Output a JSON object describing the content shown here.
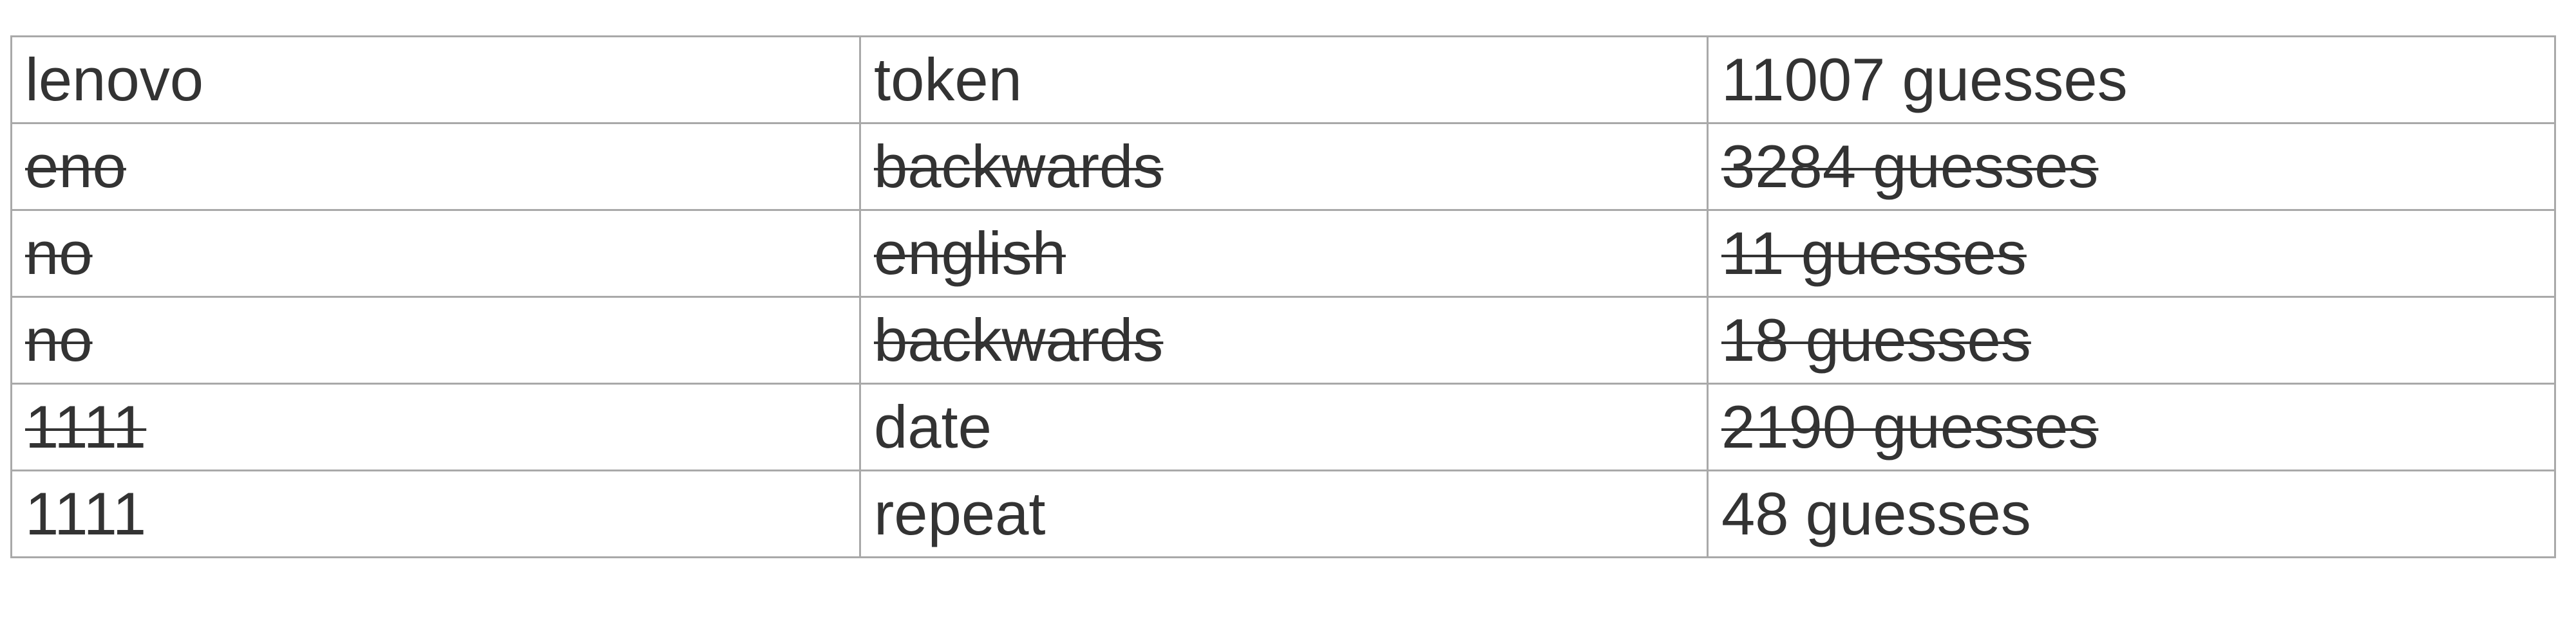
{
  "table": {
    "rows": [
      {
        "token": "lenovo",
        "pattern": "token",
        "guesses": "11007 guesses",
        "struck": [
          false,
          false,
          false
        ]
      },
      {
        "token": "eno",
        "pattern": "backwards",
        "guesses": "3284 guesses",
        "struck": [
          true,
          true,
          true
        ]
      },
      {
        "token": "no",
        "pattern": "english",
        "guesses": "11 guesses",
        "struck": [
          true,
          true,
          true
        ]
      },
      {
        "token": "no",
        "pattern": "backwards",
        "guesses": "18 guesses",
        "struck": [
          true,
          true,
          true
        ]
      },
      {
        "token": "1111",
        "pattern": "date",
        "guesses": "2190 guesses",
        "struck": [
          true,
          false,
          true
        ]
      },
      {
        "token": "1111",
        "pattern": "repeat",
        "guesses": "48 guesses",
        "struck": [
          false,
          false,
          false
        ]
      }
    ]
  }
}
